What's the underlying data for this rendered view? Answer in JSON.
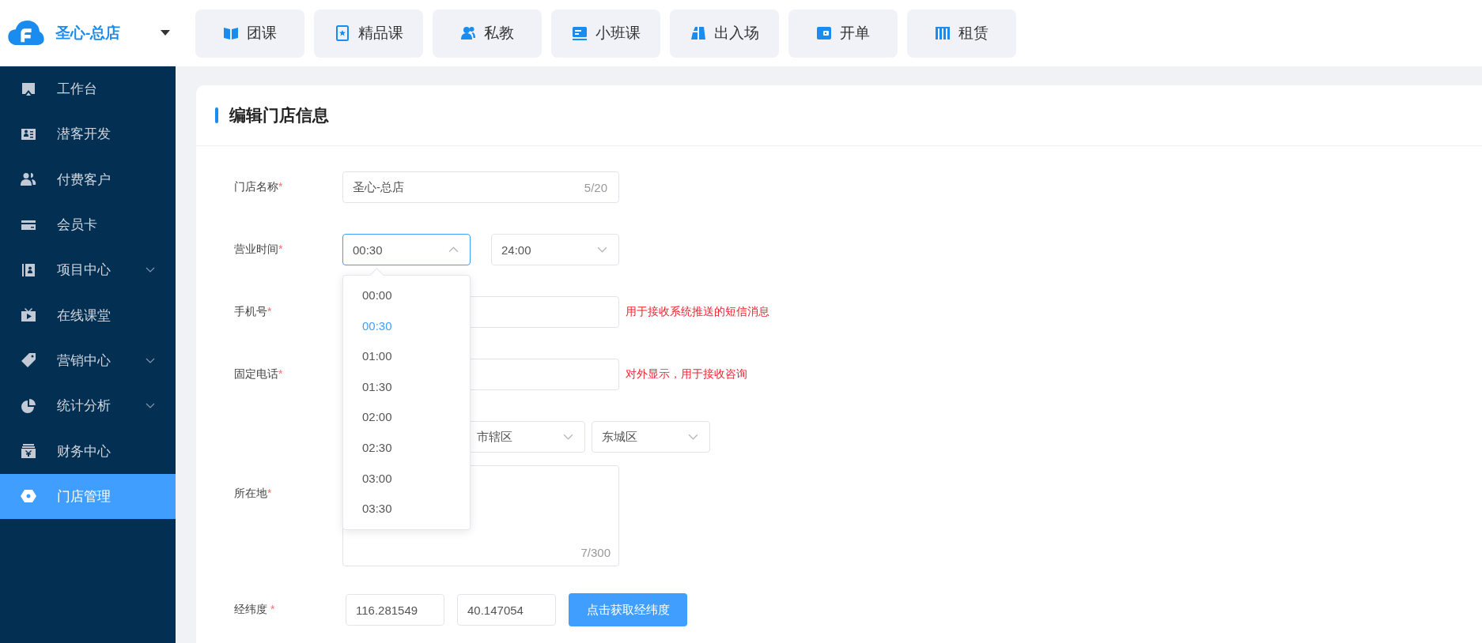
{
  "brand": {
    "name": "圣心-总店"
  },
  "top_nav": [
    {
      "label": "团课"
    },
    {
      "label": "精品课"
    },
    {
      "label": "私教"
    },
    {
      "label": "小班课"
    },
    {
      "label": "出入场"
    },
    {
      "label": "开单"
    },
    {
      "label": "租赁"
    }
  ],
  "sidebar": {
    "items": [
      {
        "label": "工作台",
        "has_submenu": false,
        "selected": false
      },
      {
        "label": "潜客开发",
        "has_submenu": false,
        "selected": false
      },
      {
        "label": "付费客户",
        "has_submenu": false,
        "selected": false
      },
      {
        "label": "会员卡",
        "has_submenu": false,
        "selected": false
      },
      {
        "label": "项目中心",
        "has_submenu": true,
        "selected": false
      },
      {
        "label": "在线课堂",
        "has_submenu": false,
        "selected": false
      },
      {
        "label": "营销中心",
        "has_submenu": true,
        "selected": false
      },
      {
        "label": "统计分析",
        "has_submenu": true,
        "selected": false
      },
      {
        "label": "财务中心",
        "has_submenu": false,
        "selected": false
      },
      {
        "label": "门店管理",
        "has_submenu": false,
        "selected": true
      }
    ]
  },
  "page": {
    "title": "编辑门店信息"
  },
  "form": {
    "store_name": {
      "label": "门店名称",
      "required_mark": "*",
      "value": "圣心-总店",
      "counter": "5/20"
    },
    "business_hours": {
      "label": "营业时间",
      "required_mark": "*",
      "start": {
        "value": "00:30",
        "open": true,
        "options": [
          {
            "label": "00:00",
            "selected": false
          },
          {
            "label": "00:30",
            "selected": true
          },
          {
            "label": "01:00",
            "selected": false
          },
          {
            "label": "01:30",
            "selected": false
          },
          {
            "label": "02:00",
            "selected": false
          },
          {
            "label": "02:30",
            "selected": false
          },
          {
            "label": "03:00",
            "selected": false
          },
          {
            "label": "03:30",
            "selected": false
          }
        ]
      },
      "end": {
        "value": "24:00",
        "open": false
      }
    },
    "mobile": {
      "label": "手机号",
      "required_mark": "*",
      "hint": "用于接收系统推送的短信消息"
    },
    "landline": {
      "label": "固定电话",
      "required_mark": "*",
      "hint": "对外显示，用于接收咨询"
    },
    "location": {
      "label": "所在地",
      "required_mark": "*",
      "district_selects": [
        {
          "value": "市辖区"
        },
        {
          "value": "东城区"
        }
      ],
      "address_counter": "7/300"
    },
    "coordinates": {
      "label": "经纬度",
      "required_mark": "*",
      "longitude": "116.281549",
      "latitude": "40.147054",
      "button": "点击获取经纬度"
    }
  }
}
